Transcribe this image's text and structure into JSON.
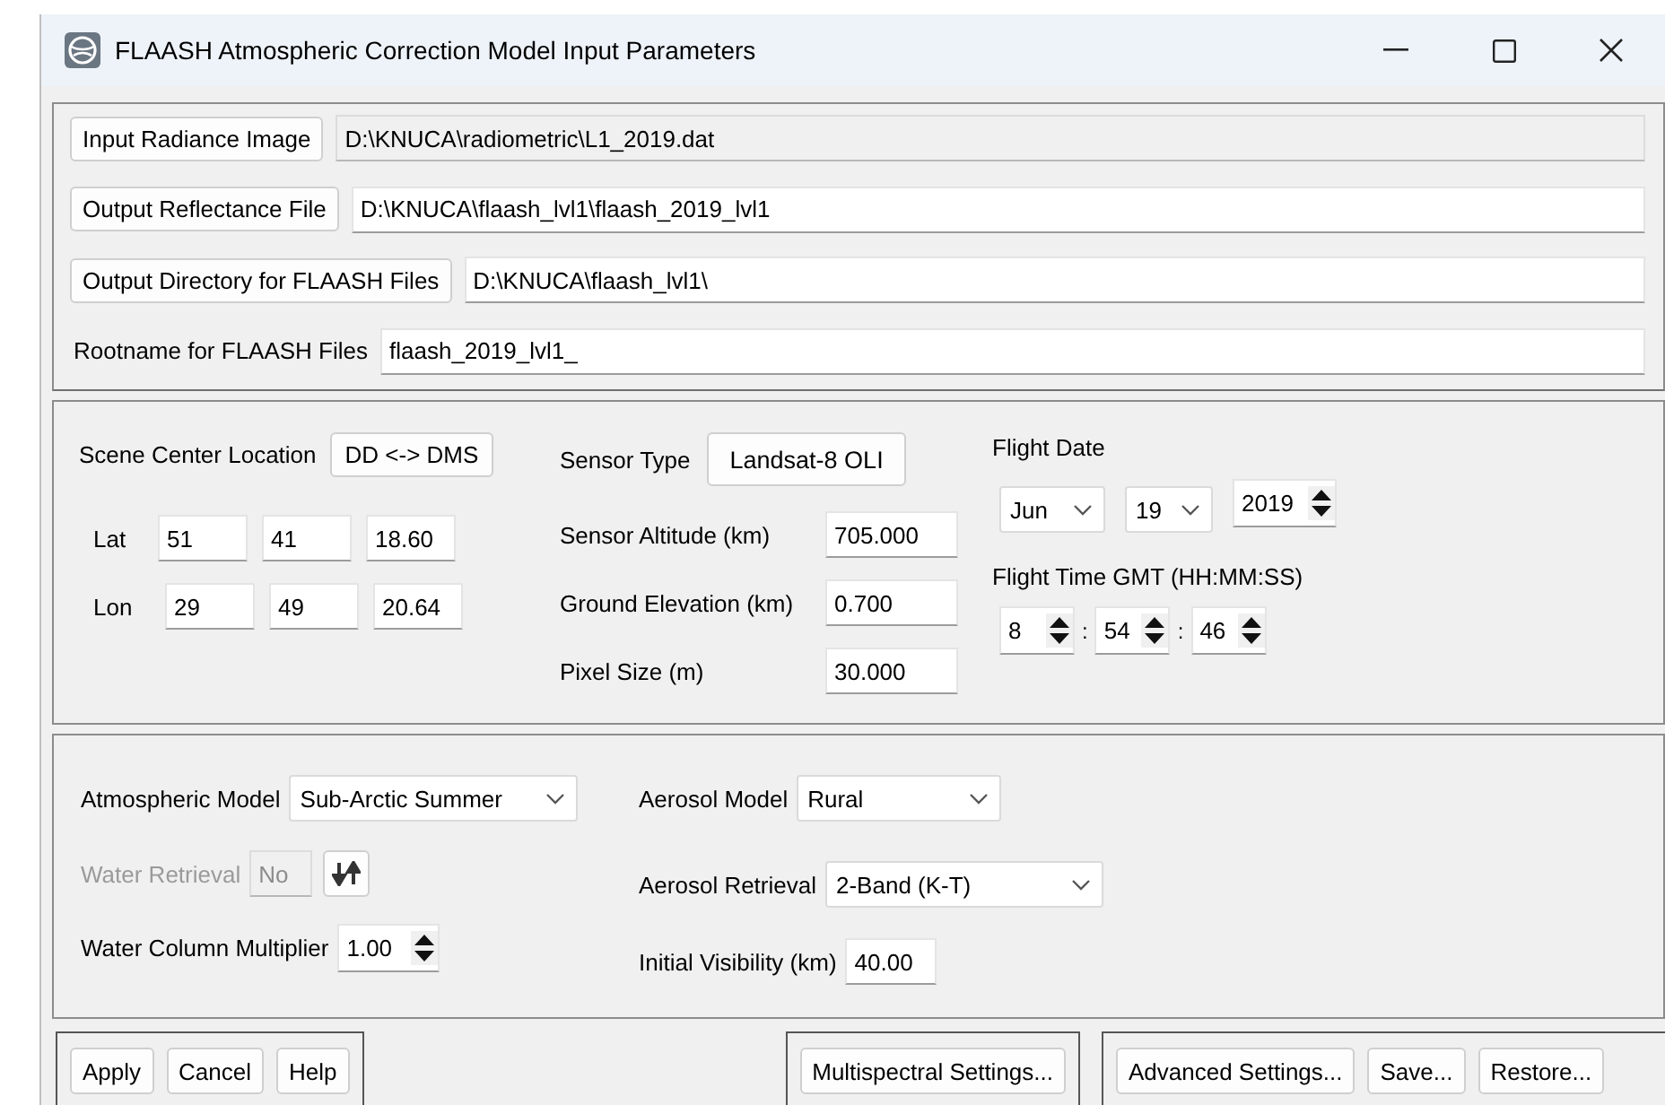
{
  "window": {
    "title": "FLAASH Atmospheric Correction Model Input Parameters"
  },
  "file_rows": [
    {
      "kind": "button",
      "label": "Input Radiance Image",
      "value": "D:\\KNUCA\\radiometric\\L1_2019.dat",
      "disabled": true
    },
    {
      "kind": "button",
      "label": "Output Reflectance File",
      "value": "D:\\KNUCA\\flaash_lvl1\\flaash_2019_lvl1",
      "disabled": false
    },
    {
      "kind": "button",
      "label": "Output Directory for FLAASH Files",
      "value": "D:\\KNUCA\\flaash_lvl1\\",
      "disabled": false
    },
    {
      "kind": "label",
      "label": "Rootname for FLAASH Files",
      "value": "flaash_2019_lvl1_",
      "disabled": false
    }
  ],
  "scene": {
    "location_label": "Scene Center Location",
    "format_button": "DD <-> DMS",
    "coordinates": [
      {
        "label": "Lat",
        "values": [
          "51",
          "41",
          "18.60"
        ]
      },
      {
        "label": "Lon",
        "values": [
          "29",
          "49",
          "20.64"
        ]
      }
    ],
    "sensor_type": {
      "label": "Sensor Type",
      "value": "Landsat-8 OLI"
    },
    "sensor_fields": [
      {
        "label": "Sensor Altitude (km)",
        "value": "705.000"
      },
      {
        "label": "Ground Elevation (km)",
        "value": "0.700"
      },
      {
        "label": "Pixel Size (m)",
        "value": "30.000"
      }
    ],
    "flight_date": {
      "label": "Flight Date",
      "month": "Jun",
      "day": "19",
      "year": "2019"
    },
    "flight_time": {
      "label": "Flight Time GMT (HH:MM:SS)",
      "values": [
        "8",
        "54",
        "46"
      ],
      "separators": [
        ":",
        ":"
      ]
    }
  },
  "atmosphere": {
    "atmospheric_model": {
      "label": "Atmospheric Model",
      "value": "Sub-Arctic Summer"
    },
    "water_retrieval": {
      "label": "Water Retrieval",
      "value": "No",
      "disabled": true
    },
    "water_column_multiplier": {
      "label": "Water Column Multiplier",
      "value": "1.00"
    },
    "aerosol_model": {
      "label": "Aerosol Model",
      "value": "Rural"
    },
    "aerosol_retrieval": {
      "label": "Aerosol Retrieval",
      "value": "2-Band (K-T)"
    },
    "initial_visibility": {
      "label": "Initial Visibility (km)",
      "value": "40.00"
    }
  },
  "button_groups": [
    [
      "Apply",
      "Cancel",
      "Help"
    ],
    [
      "Multispectral Settings..."
    ],
    [
      "Advanced Settings...",
      "Save...",
      "Restore..."
    ]
  ]
}
